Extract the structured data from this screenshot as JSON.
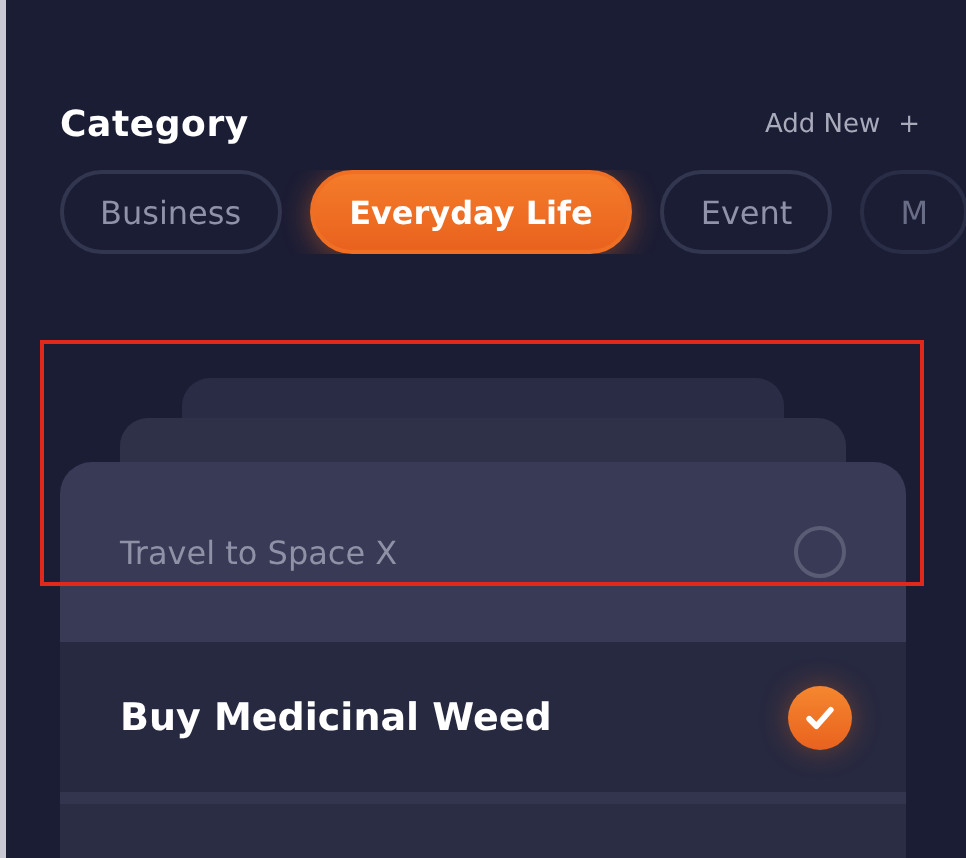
{
  "category": {
    "title": "Category",
    "add_new": {
      "label": "Add New",
      "icon": "+"
    }
  },
  "chips": [
    {
      "label": "Business",
      "selected": false
    },
    {
      "label": "Everyday Life",
      "selected": true
    },
    {
      "label": "Event",
      "selected": false
    },
    {
      "label": "M",
      "selected": false
    }
  ],
  "tasks": [
    {
      "text": "Travel to Space X",
      "checked": false
    },
    {
      "text": "Buy Medicinal Weed",
      "checked": true
    }
  ]
}
